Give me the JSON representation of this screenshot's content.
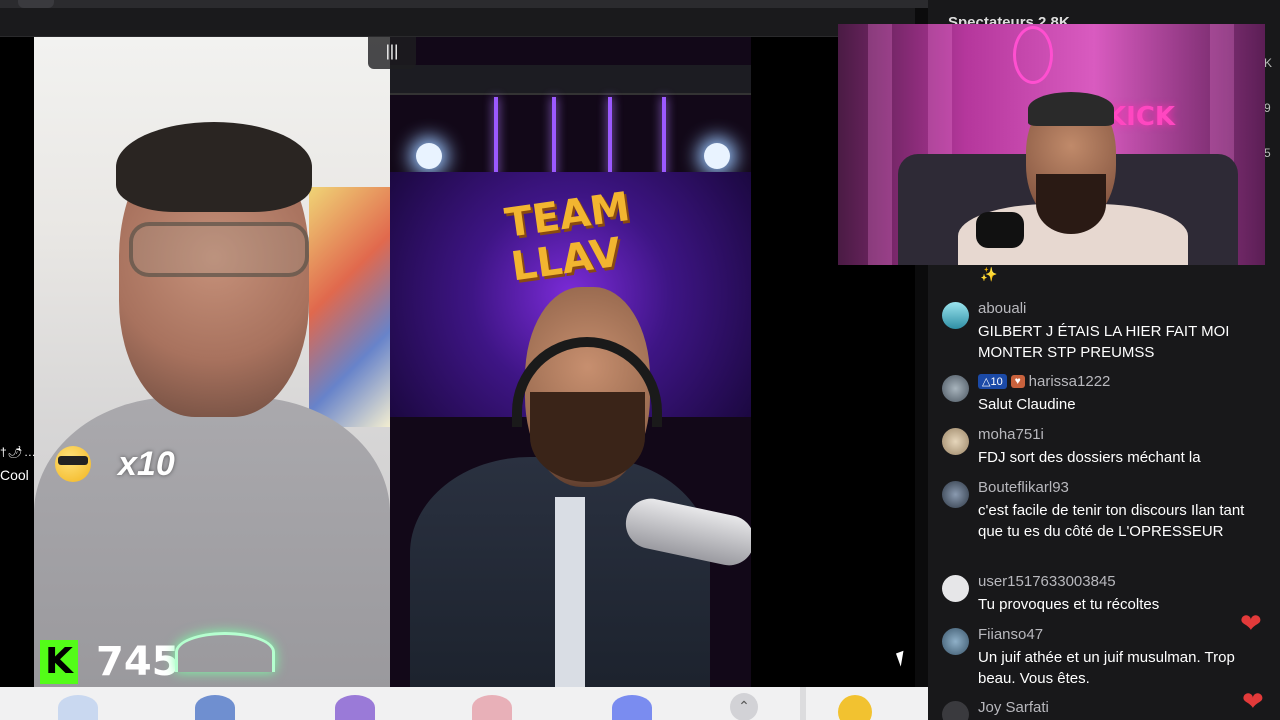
{
  "overlay": {
    "audio_icon": "audio-bars-icon",
    "gift_label": "Cool",
    "gift_icons": "†🌶…",
    "multiplier": "x10",
    "kick_logo": "K",
    "counter": "745",
    "team_banner": "TEAM LLAV"
  },
  "chat": {
    "header": "Spectateurs 2.8K",
    "edge_numbers": [
      "K",
      "9",
      "5"
    ],
    "messages": [
      {
        "user": "abouali",
        "text": "GILBERT J ÉTAIS LA HIER FAIT MOI MONTER STP PREUMSS",
        "avatar_color": "#4fb0c0"
      },
      {
        "user": "harissa1222",
        "text": "Salut Claudine",
        "badges": [
          "10"
        ],
        "avatar_color": "#7b8a95"
      },
      {
        "user": "moha751i",
        "text": "FDJ sort des dossiers méchant la",
        "avatar_color": "#c9b79a"
      },
      {
        "user": "Bouteflikarl93",
        "text": "c'est facile de tenir ton discours Ilan tant que tu es du côté de L'OPRESSEUR",
        "avatar_color": "#6a7a90"
      },
      {
        "user": "user1517633003845",
        "text": "Tu provoques et tu récoltes",
        "avatar_color": "#d8d8da"
      },
      {
        "user": "Fiianso47",
        "text": "Un juif athée et un juif musulman. Trop beau. Vous êtes.",
        "avatar_color": "#5f7f98"
      },
      {
        "user": "Joy Sarfati",
        "text": "",
        "avatar_color": "#3a3a3e"
      }
    ]
  },
  "colors": {
    "kick_green": "#53fc18",
    "chat_bg": "#18181a",
    "heart": "#e23a3a"
  }
}
